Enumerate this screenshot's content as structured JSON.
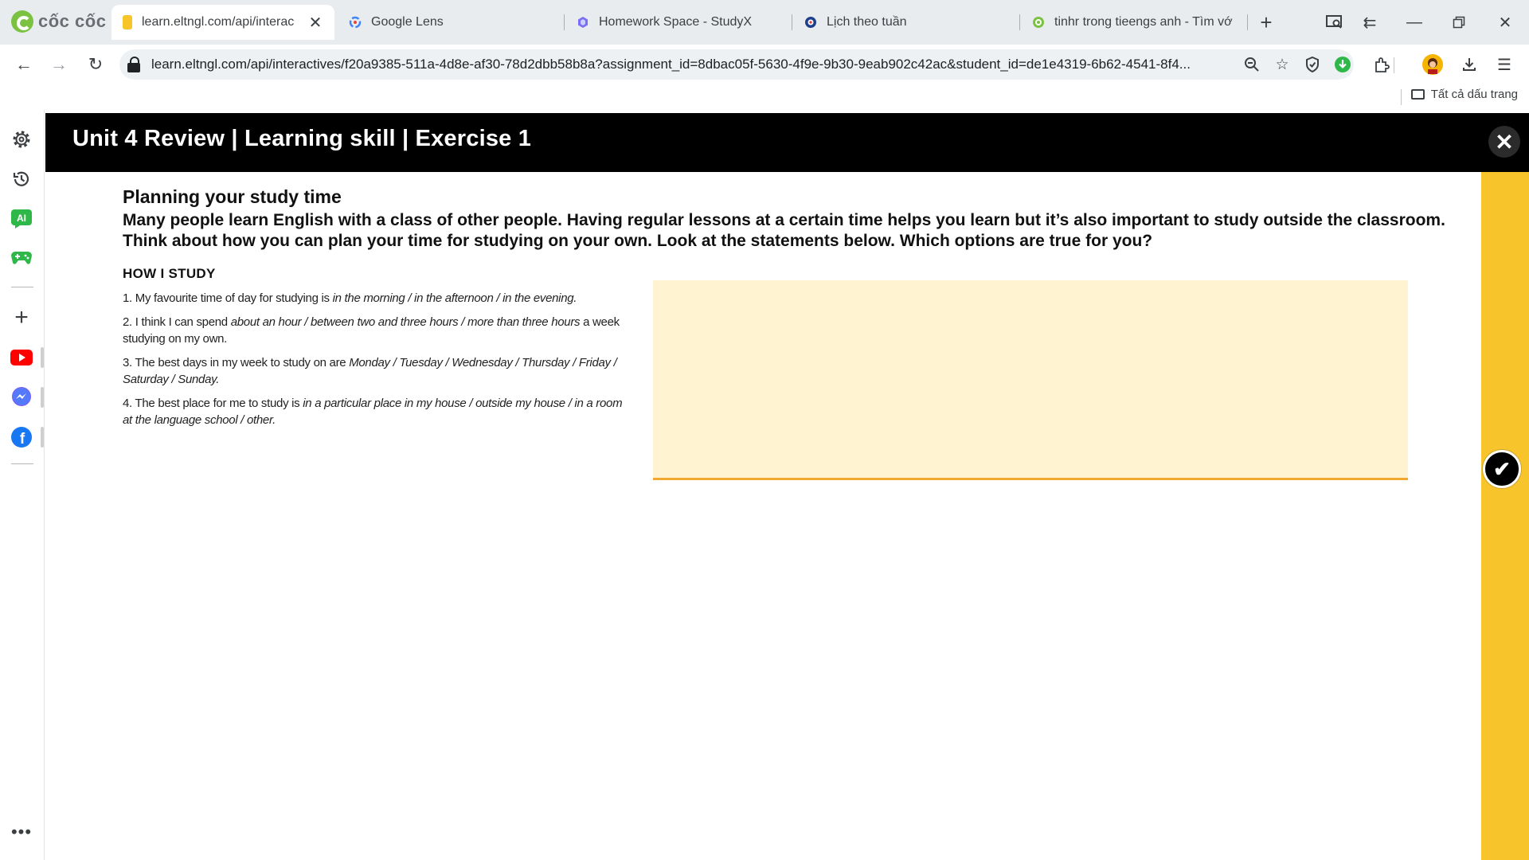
{
  "browser": {
    "brand": "cốc cốc",
    "tabs": [
      {
        "title": "learn.eltngl.com/api/interac",
        "active": true,
        "icon": "yellow-page-icon"
      },
      {
        "title": "Google Lens",
        "active": false,
        "icon": "google-lens-icon"
      },
      {
        "title": "Homework Space - StudyX",
        "active": false,
        "icon": "studyx-icon"
      },
      {
        "title": "Lịch theo tuần",
        "active": false,
        "icon": "calendar-site-icon"
      },
      {
        "title": "tinhr trong tieengs anh - Tìm vớ",
        "active": false,
        "icon": "coccoc-search-icon"
      }
    ],
    "url": "learn.eltngl.com/api/interactives/f20a9385-511a-4d8e-af30-78d2dbb58b8a?assignment_id=8dbac05f-5630-4f9e-9b30-9eab902c42ac&student_id=de1e4319-6b62-4541-8f4...",
    "bookmarks_all": "Tất cả dấu trang"
  },
  "exercise": {
    "header_title": "Unit 4 Review | Learning skill | Exercise 1",
    "title": "Planning your study time",
    "instructions": "Many people learn English with a class of other people. Having regular lessons at a certain time helps you learn but it’s also important to study outside the classroom. Think about how you can plan your time for studying on your own. Look at the statements below. Which options are true for you?",
    "section_heading": "HOW I STUDY",
    "statements": [
      {
        "pre": "1. My favourite time of day for studying is ",
        "opts": "in the morning / in the afternoon / in the evening.",
        "post": ""
      },
      {
        "pre": "2. I think I can spend ",
        "opts": "about an hour / between two and three hours / more than three hours",
        "post": " a week studying on my own."
      },
      {
        "pre": "3. The best days in my week to study on are ",
        "opts": "Monday / Tuesday / Wednesday / Thursday / Friday / Saturday / Sunday.",
        "post": ""
      },
      {
        "pre": "4. The best place for me to study is ",
        "opts": "in a particular place in my house / outside my house / in a room at the language school / other.",
        "post": ""
      }
    ]
  },
  "colors": {
    "accent_yellow": "#f8c42c",
    "answer_box": "#fff3d1",
    "answer_underline": "#f0a830",
    "header_bg": "#000000"
  }
}
